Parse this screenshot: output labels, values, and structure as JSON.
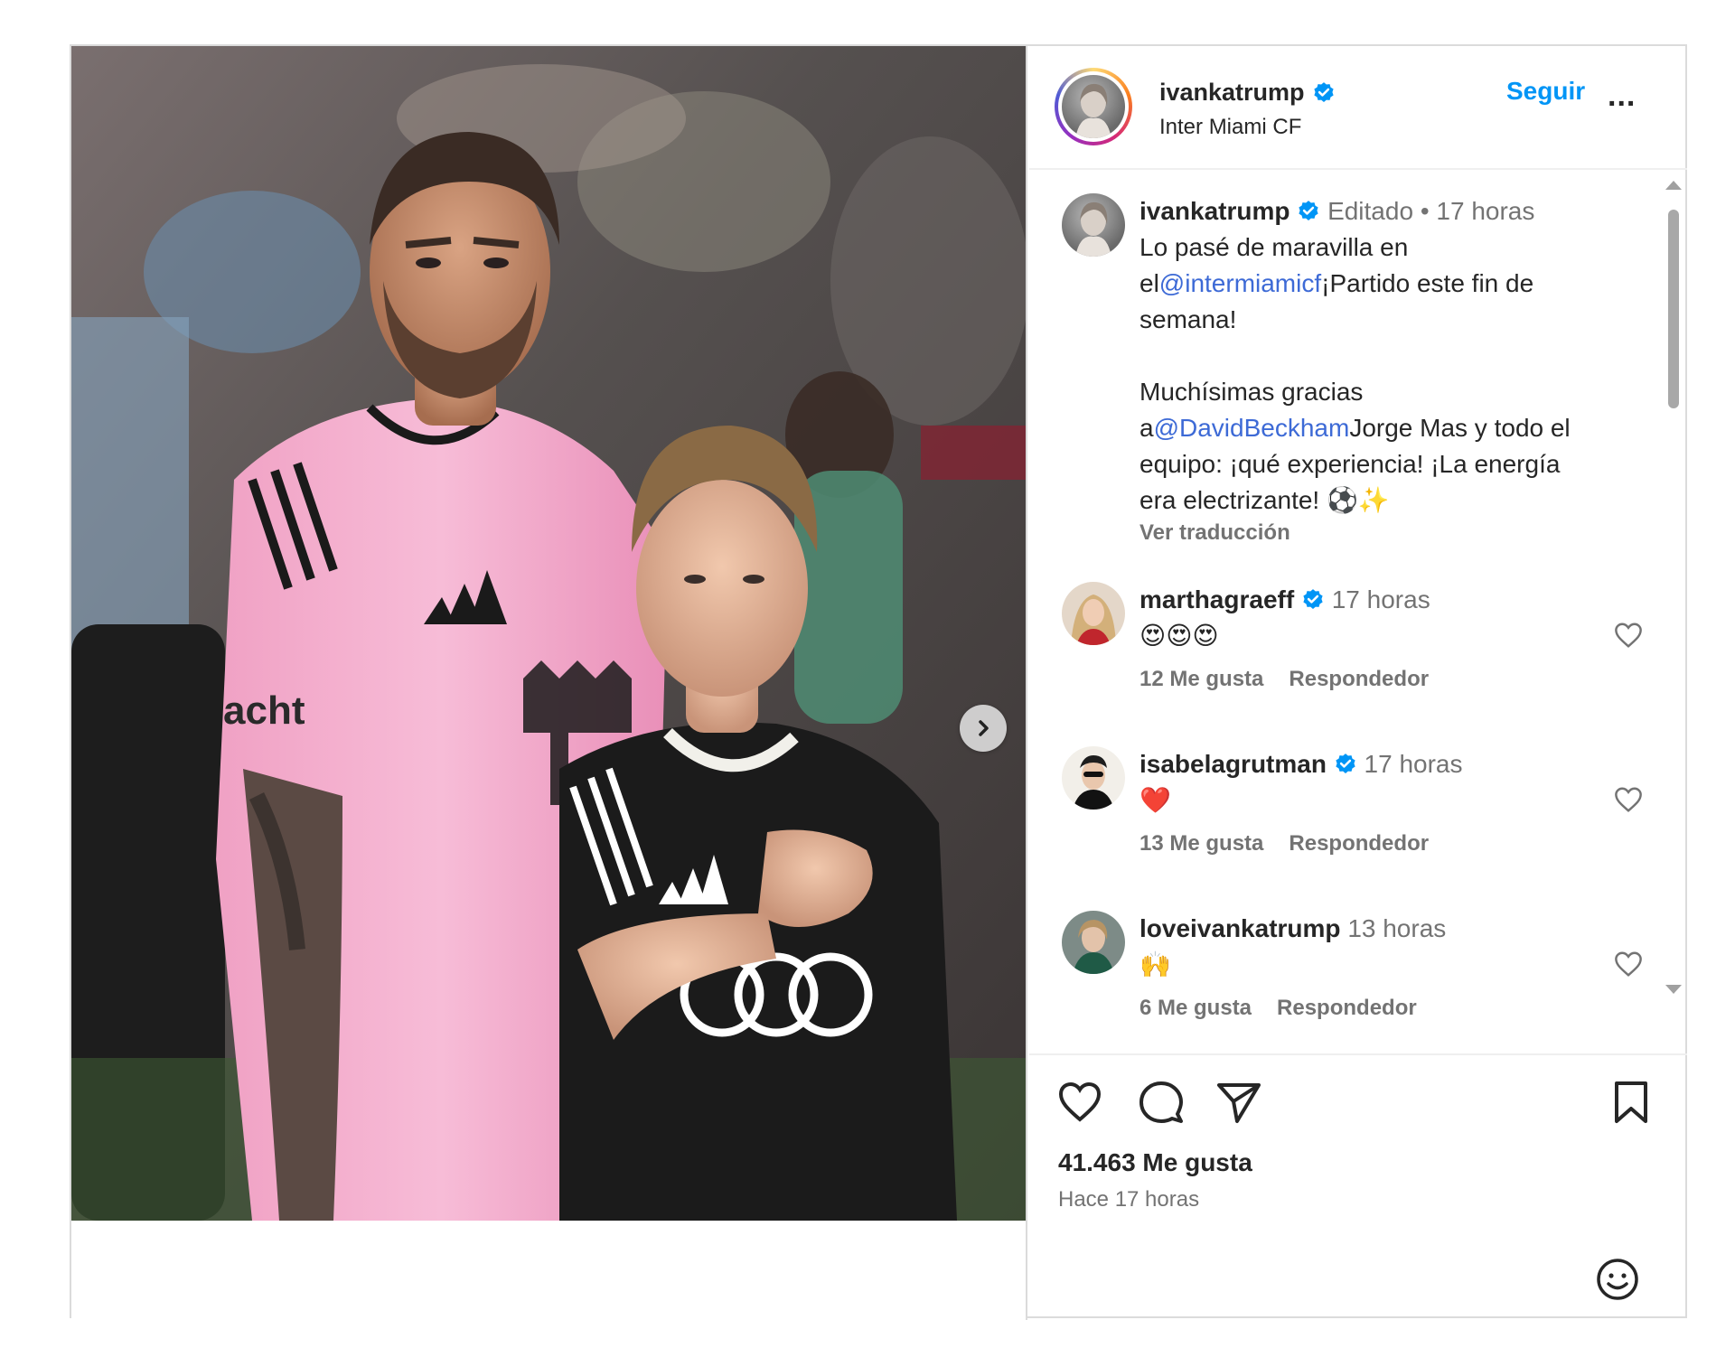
{
  "header": {
    "username": "ivankatrump",
    "location": "Inter Miami CF",
    "follow_label": "Seguir",
    "more_label": "..."
  },
  "caption": {
    "username": "ivankatrump",
    "edited": "Editado",
    "separator": "•",
    "time": "17 horas",
    "line1": "Lo pasé de maravilla en",
    "line2_pre": "el",
    "line2_mention": "@intermiamicf",
    "line2_post": "¡Partido este fin de",
    "line3": "semana!",
    "line4": "Muchísimas gracias",
    "line5_pre": "a",
    "line5_mention": "@DavidBeckham",
    "line5_post": "Jorge Mas y todo el",
    "line6": "equipo: ¡qué experiencia! ¡La energía",
    "line7": "era electrizante! ⚽✨",
    "translate": "Ver traducción"
  },
  "comments": [
    {
      "username": "marthagraeff",
      "verified": true,
      "time": "17 horas",
      "text": "😍😍😍",
      "likes": "12 Me gusta",
      "reply": "Respondedor"
    },
    {
      "username": "isabelagrutman",
      "verified": true,
      "time": "17 horas",
      "text": "❤️",
      "likes": "13 Me gusta",
      "reply": "Respondedor"
    },
    {
      "username": "loveivankatrump",
      "verified": false,
      "time": "13 horas",
      "text": "🙌",
      "likes": "6 Me gusta",
      "reply": "Respondedor"
    }
  ],
  "footer": {
    "likes_count": "41.463 Me gusta",
    "posted": "Hace 17 horas"
  },
  "icons": {
    "like": "heart-icon",
    "comment": "comment-icon",
    "share": "send-icon",
    "save": "bookmark-icon",
    "emoji": "emoji-icon",
    "next": "chevron-right-icon",
    "verified": "verified-badge-icon"
  },
  "colors": {
    "link": "#0095f6",
    "mention": "#3d6ad6",
    "verified": "#0095f6",
    "muted": "#737373",
    "text": "#262626",
    "jersey_pink": "#f2a6c8",
    "jersey_black": "#1b1b1b"
  }
}
